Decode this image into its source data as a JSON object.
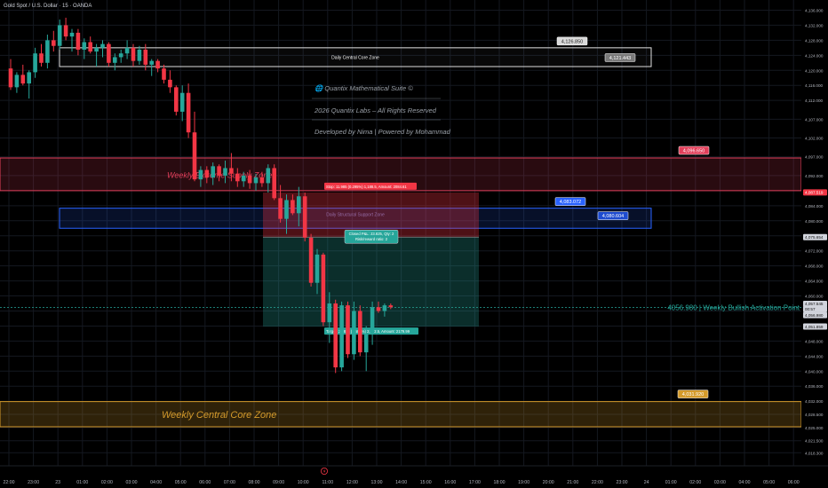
{
  "symbol_title": "Gold Spot / U.S. Dollar · 15 · OANDA",
  "colors": {
    "background": "#000000",
    "grid": "#141820",
    "up": "#26a69a",
    "down": "#f23645",
    "text": "#b2b5be",
    "supply": "#e23f5a",
    "support": "#2962ff",
    "core_gold": "#d49a2a",
    "white_box": "#ffffff"
  },
  "chart_data": {
    "type": "candlestick",
    "title": "Gold Spot / U.S. Dollar · 15 · OANDA",
    "ylim": [
      4016,
      4138
    ],
    "y_ticks": [
      "4,136.000",
      "4,132.000",
      "4,128.000",
      "4,124.000",
      "4,120.000",
      "4,116.000",
      "4,112.000",
      "4,107.000",
      "4,102.000",
      "4,097.000",
      "4,092.000",
      "4,088.000",
      "4,084.000",
      "4,080.000",
      "4,076.000",
      "4,072.000",
      "4,068.000",
      "4,064.000",
      "4,060.000",
      "4,056.000",
      "4,052.000",
      "4,048.000",
      "4,044.000",
      "4,040.000",
      "4,036.000",
      "4,032.000",
      "4,028.500",
      "4,025.000",
      "4,021.500",
      "4,018.300"
    ],
    "x_ticks": [
      "22:00",
      "23:00",
      "23",
      "01:00",
      "02:00",
      "03:00",
      "04:00",
      "05:00",
      "06:00",
      "07:00",
      "08:00",
      "09:00",
      "10:00",
      "11:00",
      "12:00",
      "13:00",
      "14:00",
      "15:00",
      "16:00",
      "17:00",
      "18:00",
      "19:00",
      "20:00",
      "21:00",
      "22:00",
      "23:00",
      "24",
      "01:00",
      "02:00",
      "03:00",
      "04:00",
      "05:00",
      "06:00"
    ],
    "x_tick_hours": [
      0,
      1,
      2,
      3,
      4,
      5,
      6,
      7,
      8,
      9,
      10,
      11,
      12,
      13,
      14,
      15,
      16,
      17,
      18,
      19,
      20,
      21,
      22,
      23,
      24,
      25,
      26,
      27,
      28,
      29,
      30,
      31,
      32
    ],
    "candles_ohlc": [
      [
        4120.5,
        4123.0,
        4114.8,
        4115.5
      ],
      [
        4115.5,
        4119.5,
        4114.0,
        4118.8
      ],
      [
        4118.8,
        4121.5,
        4116.0,
        4116.5
      ],
      [
        4116.5,
        4120.0,
        4112.5,
        4119.5
      ],
      [
        4119.5,
        4126.0,
        4118.0,
        4124.5
      ],
      [
        4124.5,
        4127.0,
        4121.0,
        4122.0
      ],
      [
        4122.0,
        4129.5,
        4120.5,
        4128.0
      ],
      [
        4128.0,
        4130.5,
        4125.0,
        4126.5
      ],
      [
        4126.5,
        4133.5,
        4125.5,
        4132.0
      ],
      [
        4132.0,
        4134.0,
        4128.0,
        4129.0
      ],
      [
        4129.0,
        4131.0,
        4125.0,
        4130.0
      ],
      [
        4130.0,
        4131.0,
        4124.0,
        4125.5
      ],
      [
        4125.5,
        4128.5,
        4123.0,
        4127.5
      ],
      [
        4127.5,
        4129.0,
        4124.5,
        4125.0
      ],
      [
        4125.0,
        4127.0,
        4121.0,
        4126.0
      ],
      [
        4126.0,
        4128.0,
        4123.5,
        4127.0
      ],
      [
        4127.0,
        4127.5,
        4121.0,
        4122.0
      ],
      [
        4122.0,
        4124.5,
        4120.0,
        4123.5
      ],
      [
        4123.5,
        4125.5,
        4122.0,
        4124.5
      ],
      [
        4124.5,
        4128.0,
        4123.0,
        4126.0
      ],
      [
        4126.0,
        4127.0,
        4121.0,
        4122.5
      ],
      [
        4122.5,
        4126.5,
        4121.5,
        4125.5
      ],
      [
        4125.5,
        4127.0,
        4120.0,
        4121.5
      ],
      [
        4121.5,
        4123.0,
        4118.5,
        4122.5
      ],
      [
        4122.5,
        4123.0,
        4119.5,
        4120.5
      ],
      [
        4120.5,
        4121.5,
        4116.5,
        4117.5
      ],
      [
        4117.5,
        4120.0,
        4114.0,
        4115.5
      ],
      [
        4115.5,
        4116.0,
        4108.0,
        4109.0
      ],
      [
        4109.0,
        4116.0,
        4106.5,
        4114.0
      ],
      [
        4114.0,
        4116.5,
        4102.0,
        4103.5
      ],
      [
        4103.5,
        4109.0,
        4090.5,
        4091.0
      ],
      [
        4091.0,
        4094.5,
        4089.0,
        4093.5
      ],
      [
        4093.5,
        4094.5,
        4090.0,
        4091.5
      ],
      [
        4091.5,
        4095.5,
        4089.5,
        4094.5
      ],
      [
        4094.5,
        4095.0,
        4090.5,
        4092.0
      ],
      [
        4092.0,
        4096.0,
        4090.0,
        4094.0
      ],
      [
        4094.0,
        4098.0,
        4090.5,
        4092.5
      ],
      [
        4092.5,
        4094.0,
        4089.0,
        4090.5
      ],
      [
        4090.5,
        4093.0,
        4089.0,
        4092.0
      ],
      [
        4092.0,
        4093.5,
        4088.5,
        4090.0
      ],
      [
        4090.0,
        4092.5,
        4088.0,
        4091.5
      ],
      [
        4091.5,
        4093.0,
        4089.0,
        4090.0
      ],
      [
        4090.0,
        4095.0,
        4087.5,
        4094.0
      ],
      [
        4094.0,
        4095.0,
        4085.5,
        4086.0
      ],
      [
        4086.0,
        4089.5,
        4079.5,
        4080.5
      ],
      [
        4080.5,
        4087.0,
        4076.5,
        4085.5
      ],
      [
        4085.5,
        4087.0,
        4081.5,
        4082.0
      ],
      [
        4082.0,
        4089.0,
        4078.5,
        4086.5
      ],
      [
        4086.5,
        4087.5,
        4074.5,
        4075.5
      ],
      [
        4075.5,
        4076.5,
        4062.5,
        4063.5
      ],
      [
        4063.5,
        4072.5,
        4060.5,
        4071.0
      ],
      [
        4071.0,
        4071.5,
        4052.0,
        4053.0
      ],
      [
        4053.0,
        4061.0,
        4047.5,
        4058.0
      ],
      [
        4058.0,
        4059.0,
        4039.5,
        4041.0
      ],
      [
        4041.0,
        4058.5,
        4040.0,
        4057.5
      ],
      [
        4057.5,
        4058.5,
        4043.5,
        4044.5
      ],
      [
        4044.5,
        4058.5,
        4043.0,
        4056.0
      ],
      [
        4056.0,
        4057.5,
        4044.0,
        4045.0
      ],
      [
        4045.0,
        4052.0,
        4040.0,
        4050.0
      ],
      [
        4050.0,
        4058.5,
        4047.0,
        4057.0
      ],
      [
        4057.0,
        4058.5,
        4055.5,
        4056.0
      ],
      [
        4056.0,
        4058.0,
        4054.5,
        4057.5
      ],
      [
        4057.5,
        4058.0,
        4056.5,
        4057.0
      ]
    ],
    "zones": [
      {
        "name": "Daily Central Core Zone",
        "top": 4126.0,
        "bottom": 4121.0,
        "labels": [
          "4,126.850",
          "4,121.443"
        ]
      },
      {
        "name": "Weekly Extreme Supply Zone",
        "top": 4096.7,
        "bottom": 4088.0,
        "labels": [
          "4,096.650"
        ]
      },
      {
        "name": "Daily Structural Support Zone",
        "top": 4083.1,
        "bottom": 4080.6,
        "labels": [
          "4,083.072",
          "4,080.604"
        ]
      },
      {
        "name": "Weekly Central Core Zone",
        "top": 4031.9,
        "bottom": 4025.2,
        "labels": [
          "4,031.920"
        ]
      }
    ],
    "position": {
      "entry": 4075.65,
      "stop": 4087.52,
      "target": 4051.85,
      "stop_label": "Stop: 11.985 (0.295%) 1,188.5, Amount: 2084.61",
      "target_label": "Target: 23.825 (0.585%) 2,382.5, Amount: 2179.99",
      "closed_label_1": "Closed P&L: 23.825, Qty: 2",
      "closed_label_2": "Risk/reward ratio: 2"
    },
    "activation_point": {
      "value": 4056.98,
      "label": "4056.980 | Weekly Bullish Activation Point"
    },
    "price_tags": [
      {
        "text": "4,087.519",
        "value": 4087.52,
        "color": "#f23645"
      },
      {
        "text": "4,075.654",
        "value": 4075.65,
        "color": "#d1d4dc"
      },
      {
        "text": "4,057.545",
        "value": 4057.9,
        "color": "#d1d4dc"
      },
      {
        "text": "00:57",
        "value": 4056.5,
        "color": "#d1d4dc"
      },
      {
        "text": "4,056.980",
        "value": 4054.9,
        "color": "#d1d4dc"
      },
      {
        "text": "4,051.859",
        "value": 4051.86,
        "color": "#d1d4dc"
      }
    ]
  },
  "watermark": {
    "line1": "🌐 Quantix Mathematical Suite ©",
    "line2": "2026 Quantix Labs – All Rights Reserved",
    "line3": "Developed by Nima | Powered by Mohammad"
  }
}
